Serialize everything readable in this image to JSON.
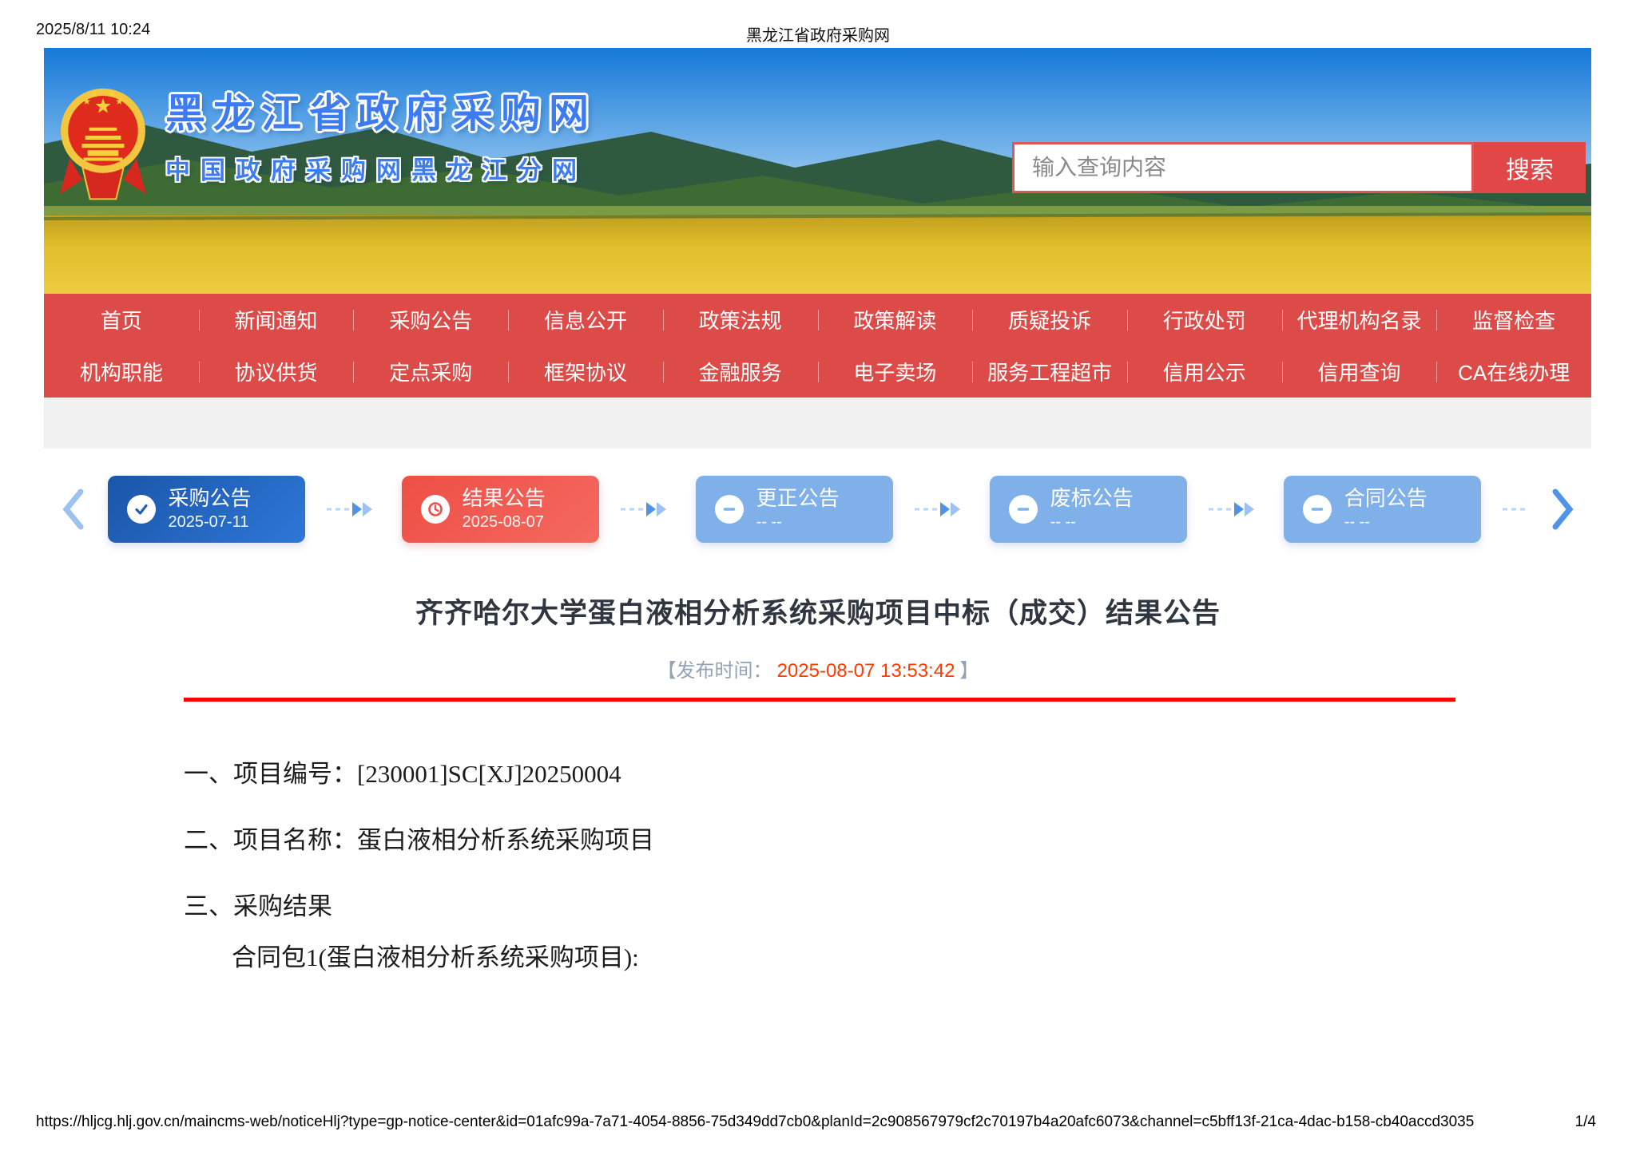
{
  "print_header": {
    "datetime": "2025/8/11 10:24",
    "title": "黑龙江省政府采购网"
  },
  "banner": {
    "site_title": "黑龙江省政府采购网",
    "site_subtitle": "中国政府采购网黑龙江分网",
    "emblem_icon": "china-national-emblem",
    "search": {
      "placeholder": "输入查询内容",
      "button_label": "搜索"
    }
  },
  "nav": {
    "row1": [
      "首页",
      "新闻通知",
      "采购公告",
      "信息公开",
      "政策法规",
      "政策解读",
      "质疑投诉",
      "行政处罚",
      "代理机构名录",
      "监督检查"
    ],
    "row2": [
      "机构职能",
      "协议供货",
      "定点采购",
      "框架协议",
      "金融服务",
      "电子卖场",
      "服务工程超市",
      "信用公示",
      "信用查询",
      "CA在线办理"
    ]
  },
  "steps": {
    "items": [
      {
        "label": "采购公告",
        "date": "2025-07-11",
        "state": "done",
        "icon": "check-circle-icon"
      },
      {
        "label": "结果公告",
        "date": "2025-08-07",
        "state": "current",
        "icon": "clock-icon"
      },
      {
        "label": "更正公告",
        "date": "-- --",
        "state": "empty",
        "icon": "minus-circle-icon"
      },
      {
        "label": "废标公告",
        "date": "-- --",
        "state": "empty",
        "icon": "minus-circle-icon"
      },
      {
        "label": "合同公告",
        "date": "-- --",
        "state": "empty",
        "icon": "minus-circle-icon"
      }
    ]
  },
  "article": {
    "title": "齐齐哈尔大学蛋白液相分析系统采购项目中标（成交）结果公告",
    "publish_prefix": "【发布时间：",
    "publish_time": "2025-08-07 13:53:42",
    "publish_suffix": "】",
    "paragraphs": [
      "一、项目编号：[230001]SC[XJ]20250004",
      "二、项目名称：蛋白液相分析系统采购项目",
      "三、采购结果",
      "合同包1(蛋白液相分析系统采购项目):"
    ]
  },
  "footer": {
    "url": "https://hljcg.hlj.gov.cn/maincms-web/noticeHlj?type=gp-notice-center&id=01afc99a-7a71-4054-8856-75d349dd7cb0&planId=2c908567979cf2c70197b4a20afc6073&channel=c5bff13f-21ca-4dac-b158-cb40accd3035",
    "page_number": "1/4"
  },
  "colors": {
    "nav_red": "#dc4b47",
    "search_border_red": "#e25555",
    "search_button_red": "#e14747",
    "step_done_blue": "#2261b4",
    "step_current_red": "#ee4f46",
    "step_pending_blue": "#7fb0ea",
    "banner_title_blue": "#3d7bf0",
    "publish_time_red": "#ff3c00",
    "divider_red": "#fe0000"
  }
}
